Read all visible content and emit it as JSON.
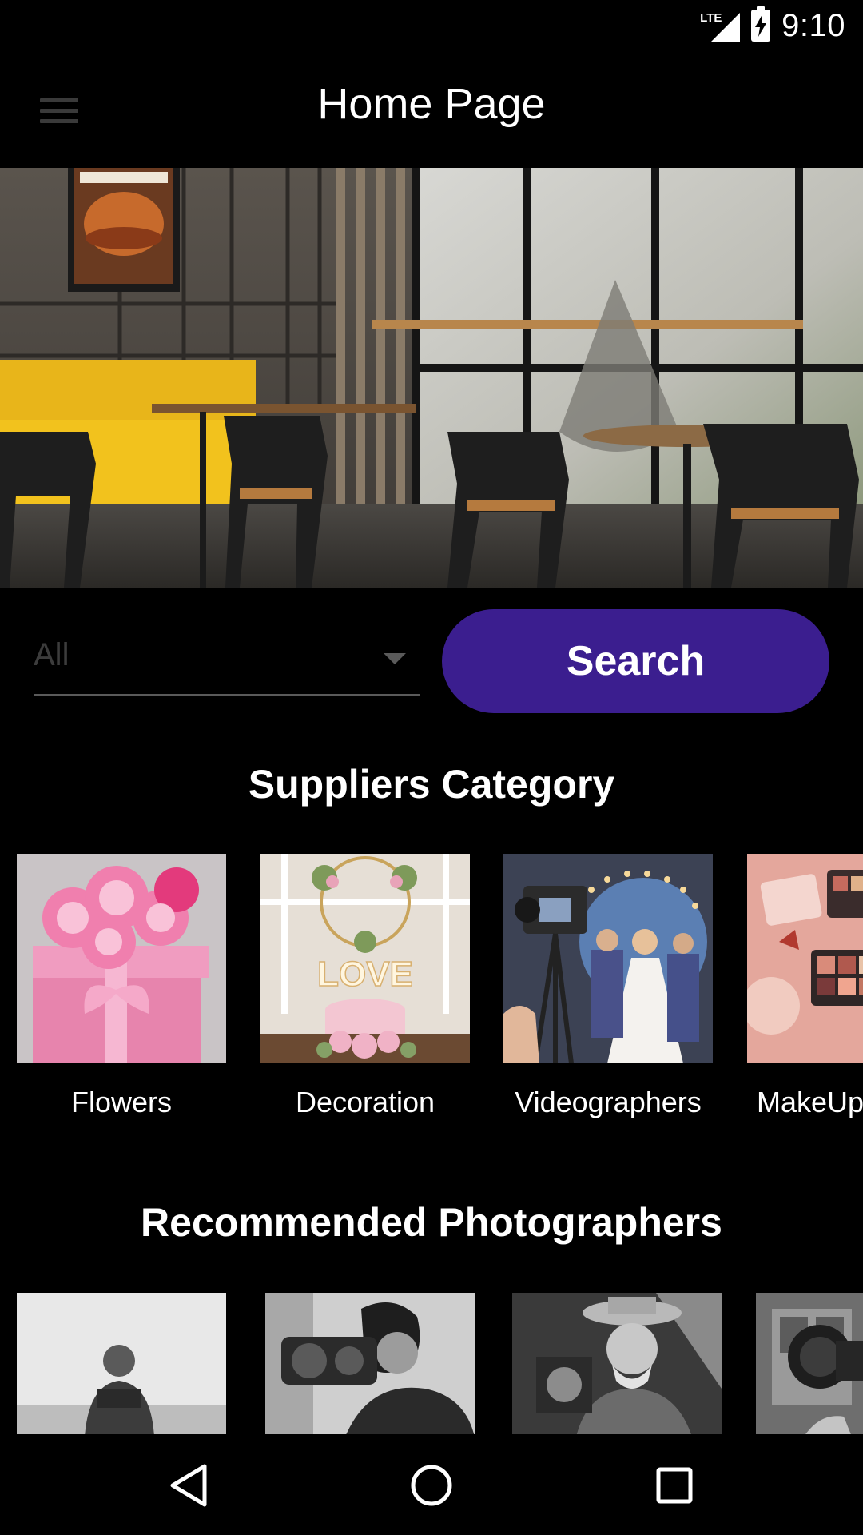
{
  "status_bar": {
    "network": "LTE",
    "time": "9:10"
  },
  "app_bar": {
    "title": "Home Page",
    "menu_icon": "hamburger-menu-icon"
  },
  "hero": {
    "image": "restaurant-interior-photo"
  },
  "search": {
    "category_value": "All",
    "button_label": "Search"
  },
  "suppliers": {
    "title": "Suppliers Category",
    "items": [
      {
        "label": "Flowers",
        "image": "pink-flowers-gift-box-photo"
      },
      {
        "label": "Decoration",
        "image": "wedding-love-decoration-photo"
      },
      {
        "label": "Videographers",
        "image": "wedding-videographer-camera-photo"
      },
      {
        "label": "MakeUp",
        "image": "makeup-palettes-photo"
      }
    ]
  },
  "photographers": {
    "title": "Recommended Photographers",
    "items": [
      {
        "image": "photographer-portrait-1"
      },
      {
        "image": "photographer-portrait-2"
      },
      {
        "image": "photographer-portrait-3"
      },
      {
        "image": "photographer-portrait-4"
      }
    ]
  },
  "nav_bar": {
    "back_icon": "back-triangle-icon",
    "home_icon": "home-circle-icon",
    "recents_icon": "recents-square-icon"
  }
}
